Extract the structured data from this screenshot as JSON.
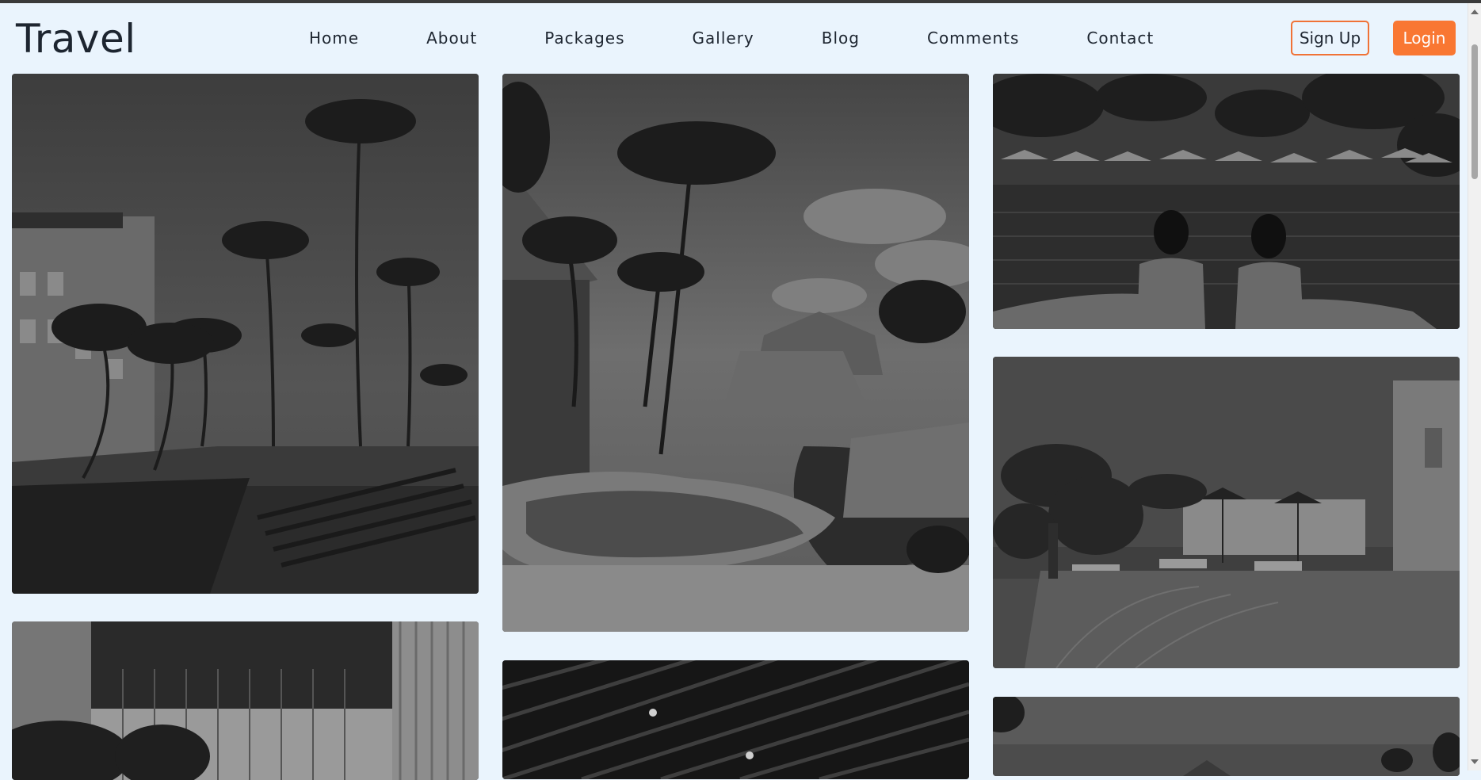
{
  "brand": {
    "logo_text": "Travel"
  },
  "nav": {
    "items": [
      {
        "label": "Home"
      },
      {
        "label": "About"
      },
      {
        "label": "Packages"
      },
      {
        "label": "Gallery"
      },
      {
        "label": "Blog"
      },
      {
        "label": "Comments"
      },
      {
        "label": "Contact"
      }
    ]
  },
  "auth": {
    "signup_label": "Sign Up",
    "login_label": "Login"
  },
  "colors": {
    "background": "#eaf4fd",
    "accent": "#f97732",
    "text": "#1d2530"
  },
  "gallery": {
    "images": [
      {
        "name": "resort-palms-pool"
      },
      {
        "name": "thatched-resort-pool"
      },
      {
        "name": "infinity-pool-swimmers"
      },
      {
        "name": "seaside-terrace-pool"
      },
      {
        "name": "building-balcony-palms"
      },
      {
        "name": "slatted-ceiling"
      },
      {
        "name": "beach-palms-partial"
      }
    ]
  }
}
